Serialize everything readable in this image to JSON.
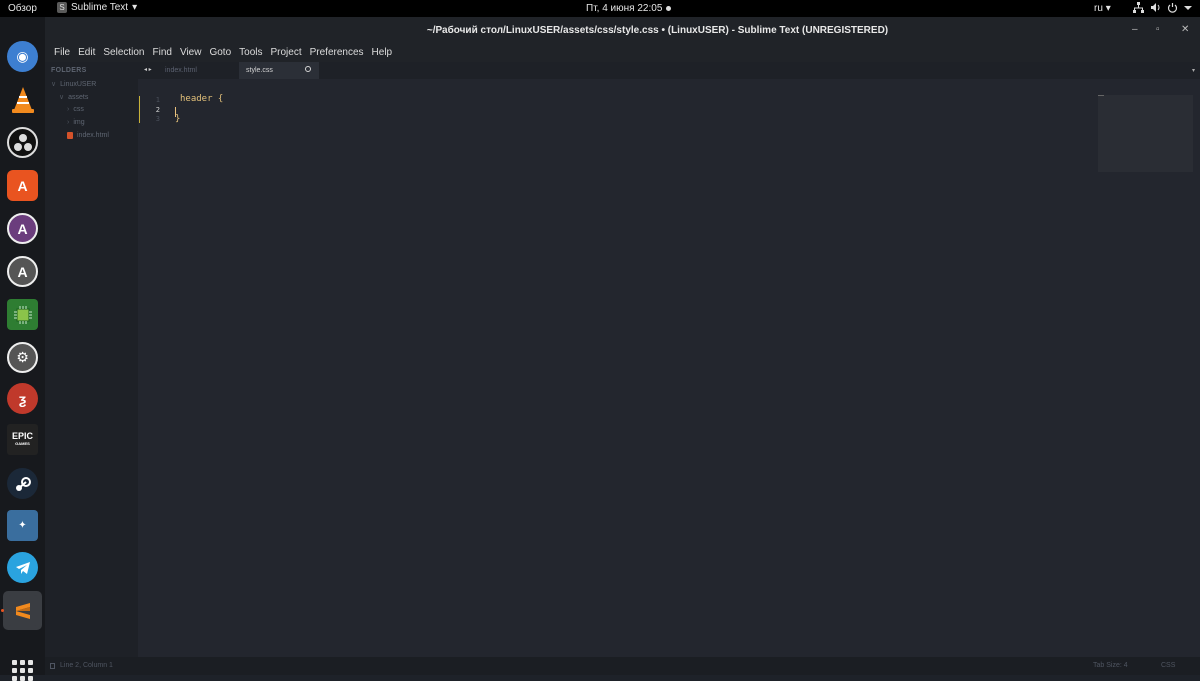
{
  "topbar": {
    "overview": "Обзор",
    "app_menu": "Sublime Text",
    "app_menu_arrow": "▾",
    "clock": "Пт, 4 июня  22:05",
    "lang": "ru",
    "lang_arrow": "▾",
    "tray_icons": [
      "network-icon",
      "volume-icon",
      "power-icon",
      "chevron-down-icon"
    ]
  },
  "dock": {
    "apps": [
      "system-monitor-icon",
      "vlc-icon",
      "obs-icon",
      "software-center-icon",
      "app-installer-icon",
      "software-updater-icon",
      "chip-icon",
      "settings-icon",
      "epic-alt-icon",
      "epic-games-icon",
      "steam-icon",
      "wine-icon",
      "telegram-icon",
      "sublime-text-icon"
    ],
    "epic_label": "EPIC",
    "epic_sub": "GAMES"
  },
  "window": {
    "title": "~/Рабочий стол/LinuxUSER/assets/css/style.css • (LinuxUSER) - Sublime Text (UNREGISTERED)",
    "minimize": "–",
    "maximize": "▫",
    "close": "✕"
  },
  "menu": [
    "File",
    "Edit",
    "Selection",
    "Find",
    "View",
    "Goto",
    "Tools",
    "Project",
    "Preferences",
    "Help"
  ],
  "sidebar": {
    "header": "FOLDERS",
    "root": "LinuxUSER",
    "assets": "assets",
    "css": "css",
    "img": "img",
    "index": "index.html"
  },
  "tabs": {
    "nav": "◂ ▸",
    "inactive": "index.html",
    "active": "style.css",
    "more": "▾"
  },
  "editor": {
    "line_numbers": [
      "1",
      "2",
      "3"
    ],
    "line1": "header {",
    "line3": "}"
  },
  "status": {
    "position": "Line 2, Column 1",
    "tab_size": "Tab Size: 4",
    "syntax": "CSS"
  },
  "colors": {
    "accent": "#e95420",
    "code": "#e2c07a",
    "background": "#23262e"
  }
}
